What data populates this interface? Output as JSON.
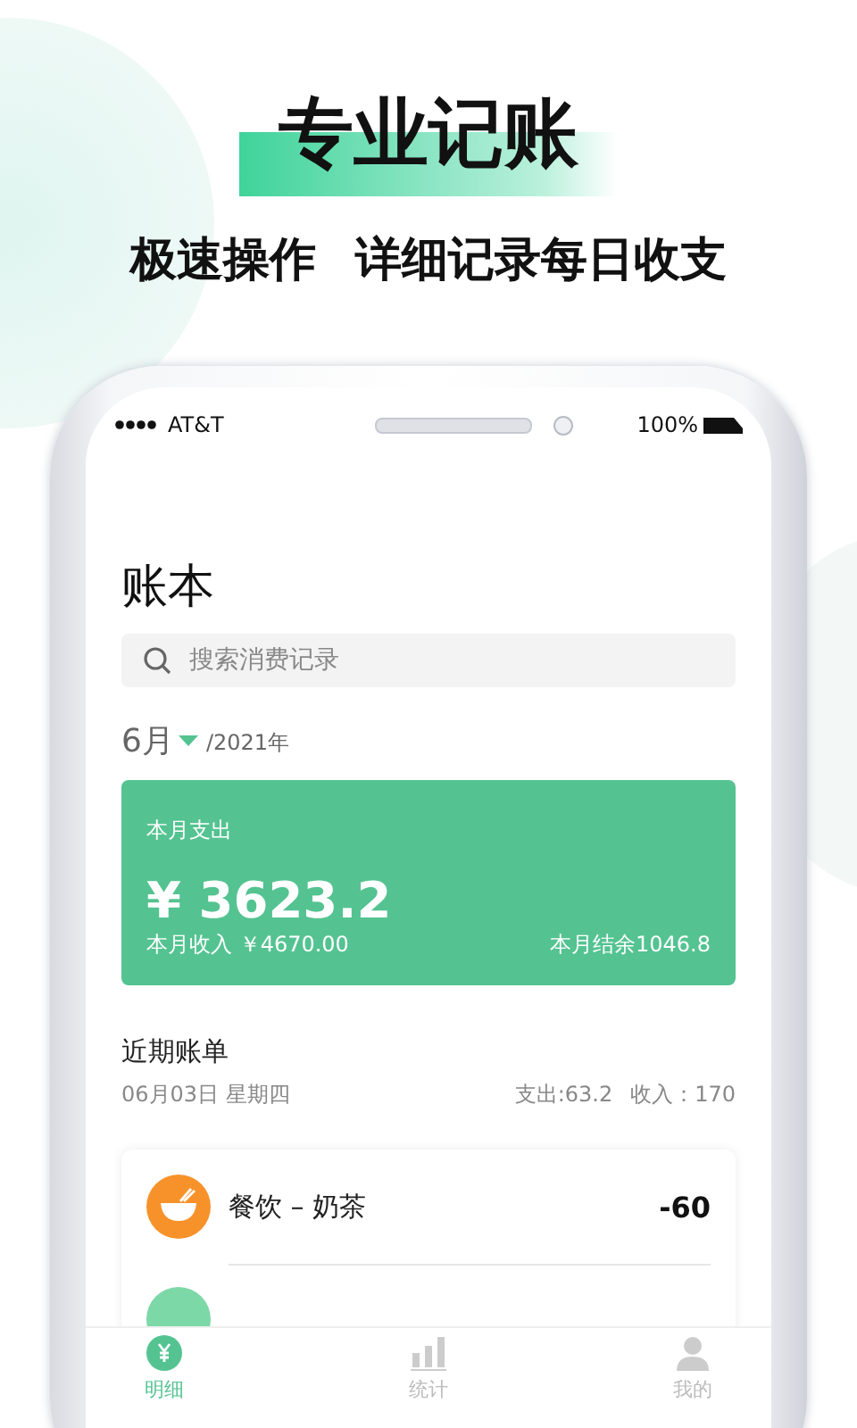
{
  "headline": "专业记账",
  "subtitle": [
    "极速操作",
    "详细记录每日收支"
  ],
  "status_bar": {
    "carrier": "AT&T",
    "battery": "100%"
  },
  "ledger": {
    "title": "账本",
    "search": {
      "placeholder": "搜索消费记录"
    },
    "month": "6月",
    "year": "/2021年",
    "summary": {
      "label": "本月支出",
      "amount": "¥ 3623.2",
      "income": "本月收入 ￥4670.00",
      "balance": "本月结余1046.8"
    }
  },
  "recent": {
    "title": "近期账单",
    "date": "06月03日 星期四",
    "expense": "支出:63.2",
    "income": "收入：170",
    "entries": [
      {
        "kind": "food",
        "label": "餐饮 – 奶茶",
        "amount": "-60",
        "color": "#f7922a"
      },
      {
        "kind": "partial",
        "color": "#7dd8a8"
      }
    ]
  },
  "tabs": [
    {
      "kind": "yen",
      "label": "明细",
      "selected": true
    },
    {
      "kind": "chart",
      "label": "统计",
      "selected": false
    },
    {
      "kind": "person",
      "label": "我的",
      "selected": false
    }
  ]
}
